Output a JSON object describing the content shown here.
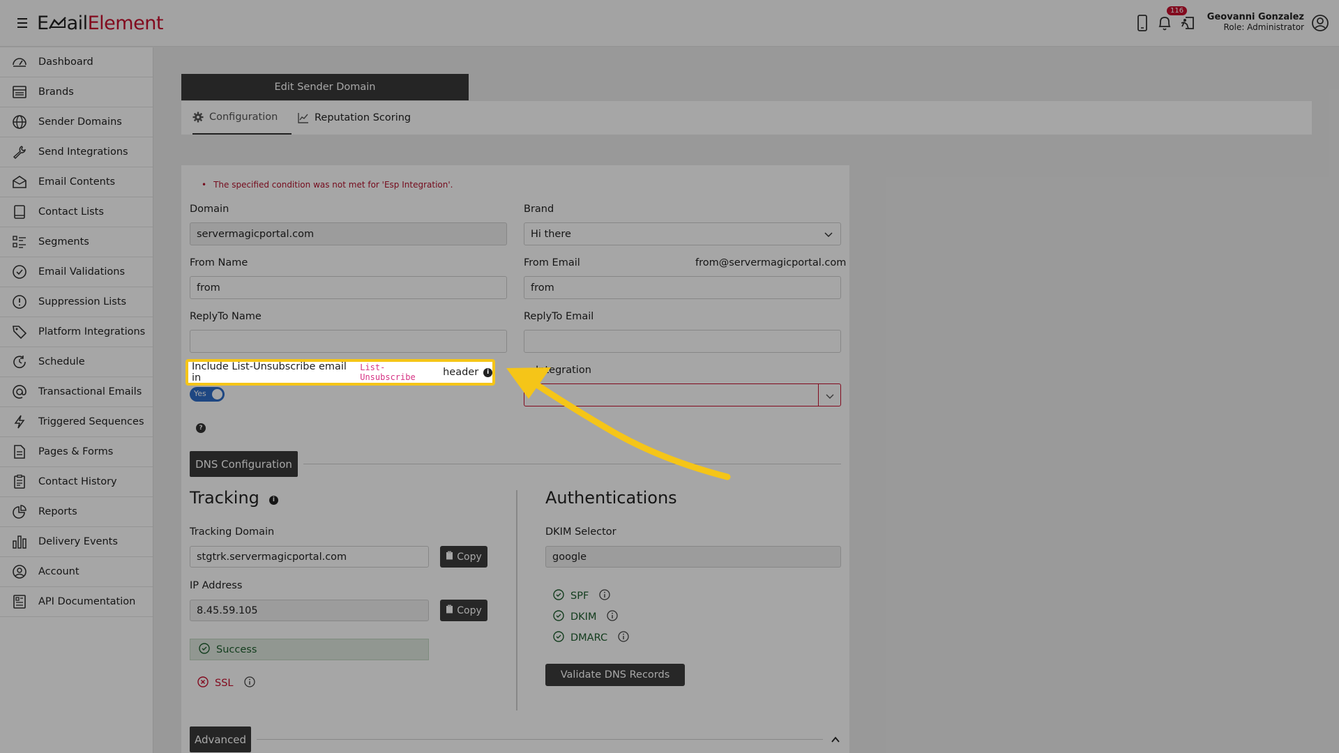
{
  "app": {
    "logo_part1": "E",
    "logo_part2": "ail",
    "logo_part3": "Element",
    "notifications_count": "116",
    "user_name": "Geovanni Gonzalez",
    "user_role": "Role: Administrator"
  },
  "sidebar": {
    "items": [
      {
        "label": "Dashboard",
        "icon": "dashboard-icon"
      },
      {
        "label": "Brands",
        "icon": "brands-icon"
      },
      {
        "label": "Sender Domains",
        "icon": "globe-icon"
      },
      {
        "label": "Send Integrations",
        "icon": "wrench-icon"
      },
      {
        "label": "Email Contents",
        "icon": "envelope-icon"
      },
      {
        "label": "Contact Lists",
        "icon": "book-icon"
      },
      {
        "label": "Segments",
        "icon": "list-icon"
      },
      {
        "label": "Email Validations",
        "icon": "check-circle-icon"
      },
      {
        "label": "Suppression Lists",
        "icon": "alert-circle-icon"
      },
      {
        "label": "Platform Integrations",
        "icon": "tag-icon"
      },
      {
        "label": "Schedule",
        "icon": "clock-icon"
      },
      {
        "label": "Transactional Emails",
        "icon": "at-icon"
      },
      {
        "label": "Triggered Sequences",
        "icon": "bolt-icon"
      },
      {
        "label": "Pages & Forms",
        "icon": "document-icon"
      },
      {
        "label": "Contact History",
        "icon": "clipboard-icon"
      },
      {
        "label": "Reports",
        "icon": "pie-chart-icon"
      },
      {
        "label": "Delivery Events",
        "icon": "bar-chart-icon"
      },
      {
        "label": "Account",
        "icon": "user-circle-icon"
      },
      {
        "label": "API Documentation",
        "icon": "api-doc-icon"
      }
    ]
  },
  "page": {
    "card_title": "Edit Sender Domain",
    "tabs": [
      {
        "label": "Configuration",
        "icon": "gear-icon",
        "active": true
      },
      {
        "label": "Reputation Scoring",
        "icon": "line-chart-icon",
        "active": false
      }
    ],
    "error_message": "The specified condition was not met for 'Esp Integration'."
  },
  "form": {
    "domain_label": "Domain",
    "domain_value": "servermagicportal.com",
    "brand_label": "Brand",
    "brand_value": "Hi there",
    "from_name_label": "From Name",
    "from_name_value": "from",
    "from_email_label": "From Email",
    "from_email_address": "from@servermagicportal.com",
    "from_email_value": "from",
    "reply_to_name_label": "ReplyTo Name",
    "reply_to_name_value": "",
    "reply_to_email_label": "ReplyTo Email",
    "reply_to_email_value": "",
    "list_unsub_text_before": "Include List-Unsubscribe email in",
    "list_unsub_code": "List-Unsubscribe",
    "list_unsub_text_after": "header",
    "toggle_label": "Yes",
    "toggle_on": true,
    "integration_label": "Integration",
    "integration_value": ""
  },
  "dns": {
    "section_button": "DNS Configuration",
    "tracking_title": "Tracking",
    "tracking_domain_label": "Tracking Domain",
    "tracking_domain_value": "stgtrk.servermagicportal.com",
    "ip_label": "IP Address",
    "ip_value": "8.45.59.105",
    "copy_label": "Copy",
    "success_text": "Success",
    "ssl_label": "SSL",
    "auth_title": "Authentications",
    "dkim_selector_label": "DKIM Selector",
    "dkim_selector_value": "google",
    "spf_label": "SPF",
    "dkim_label": "DKIM",
    "dmarc_label": "DMARC",
    "validate_button": "Validate DNS Records"
  },
  "advanced": {
    "section_button": "Advanced"
  },
  "colors": {
    "brand_red": "#c8102e",
    "toggle_blue": "#2f6ec8",
    "highlight_yellow": "#f5c518",
    "success_green": "#1e5e2e"
  }
}
